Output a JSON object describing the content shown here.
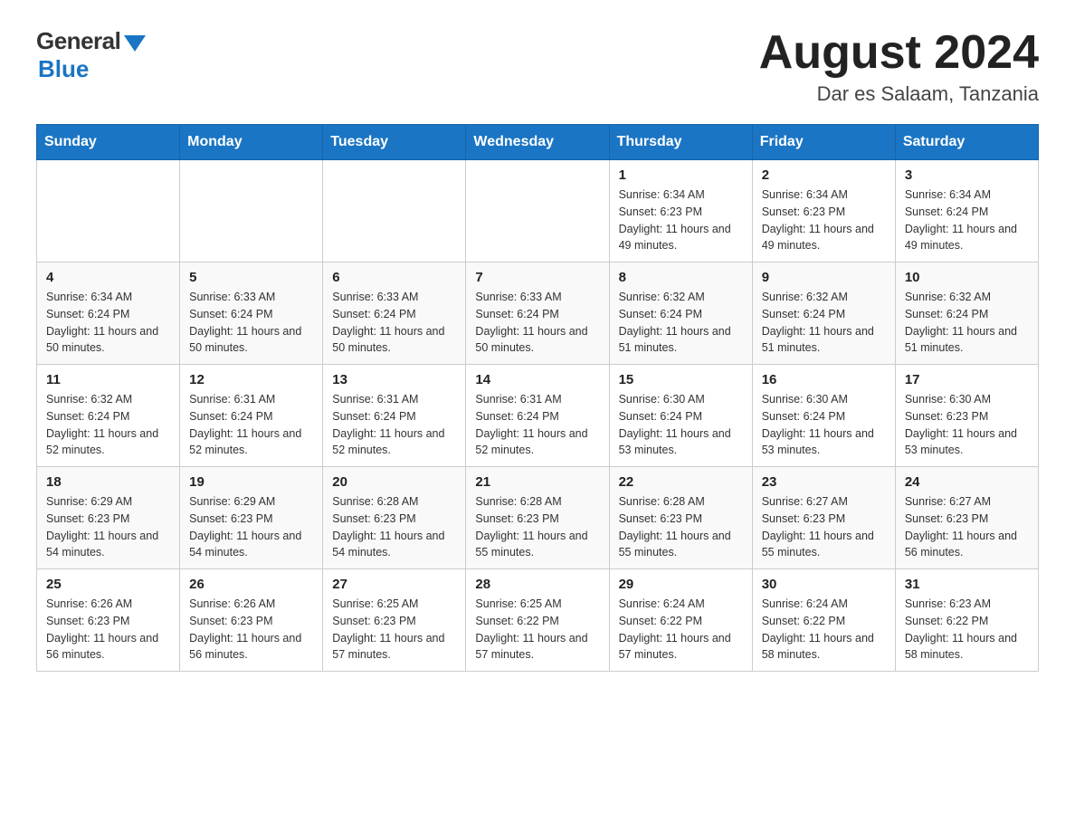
{
  "header": {
    "logo_general": "General",
    "logo_blue": "Blue",
    "month_title": "August 2024",
    "location": "Dar es Salaam, Tanzania"
  },
  "weekdays": [
    "Sunday",
    "Monday",
    "Tuesday",
    "Wednesday",
    "Thursday",
    "Friday",
    "Saturday"
  ],
  "weeks": [
    [
      {
        "day": "",
        "sunrise": "",
        "sunset": "",
        "daylight": ""
      },
      {
        "day": "",
        "sunrise": "",
        "sunset": "",
        "daylight": ""
      },
      {
        "day": "",
        "sunrise": "",
        "sunset": "",
        "daylight": ""
      },
      {
        "day": "",
        "sunrise": "",
        "sunset": "",
        "daylight": ""
      },
      {
        "day": "1",
        "sunrise": "Sunrise: 6:34 AM",
        "sunset": "Sunset: 6:23 PM",
        "daylight": "Daylight: 11 hours and 49 minutes."
      },
      {
        "day": "2",
        "sunrise": "Sunrise: 6:34 AM",
        "sunset": "Sunset: 6:23 PM",
        "daylight": "Daylight: 11 hours and 49 minutes."
      },
      {
        "day": "3",
        "sunrise": "Sunrise: 6:34 AM",
        "sunset": "Sunset: 6:24 PM",
        "daylight": "Daylight: 11 hours and 49 minutes."
      }
    ],
    [
      {
        "day": "4",
        "sunrise": "Sunrise: 6:34 AM",
        "sunset": "Sunset: 6:24 PM",
        "daylight": "Daylight: 11 hours and 50 minutes."
      },
      {
        "day": "5",
        "sunrise": "Sunrise: 6:33 AM",
        "sunset": "Sunset: 6:24 PM",
        "daylight": "Daylight: 11 hours and 50 minutes."
      },
      {
        "day": "6",
        "sunrise": "Sunrise: 6:33 AM",
        "sunset": "Sunset: 6:24 PM",
        "daylight": "Daylight: 11 hours and 50 minutes."
      },
      {
        "day": "7",
        "sunrise": "Sunrise: 6:33 AM",
        "sunset": "Sunset: 6:24 PM",
        "daylight": "Daylight: 11 hours and 50 minutes."
      },
      {
        "day": "8",
        "sunrise": "Sunrise: 6:32 AM",
        "sunset": "Sunset: 6:24 PM",
        "daylight": "Daylight: 11 hours and 51 minutes."
      },
      {
        "day": "9",
        "sunrise": "Sunrise: 6:32 AM",
        "sunset": "Sunset: 6:24 PM",
        "daylight": "Daylight: 11 hours and 51 minutes."
      },
      {
        "day": "10",
        "sunrise": "Sunrise: 6:32 AM",
        "sunset": "Sunset: 6:24 PM",
        "daylight": "Daylight: 11 hours and 51 minutes."
      }
    ],
    [
      {
        "day": "11",
        "sunrise": "Sunrise: 6:32 AM",
        "sunset": "Sunset: 6:24 PM",
        "daylight": "Daylight: 11 hours and 52 minutes."
      },
      {
        "day": "12",
        "sunrise": "Sunrise: 6:31 AM",
        "sunset": "Sunset: 6:24 PM",
        "daylight": "Daylight: 11 hours and 52 minutes."
      },
      {
        "day": "13",
        "sunrise": "Sunrise: 6:31 AM",
        "sunset": "Sunset: 6:24 PM",
        "daylight": "Daylight: 11 hours and 52 minutes."
      },
      {
        "day": "14",
        "sunrise": "Sunrise: 6:31 AM",
        "sunset": "Sunset: 6:24 PM",
        "daylight": "Daylight: 11 hours and 52 minutes."
      },
      {
        "day": "15",
        "sunrise": "Sunrise: 6:30 AM",
        "sunset": "Sunset: 6:24 PM",
        "daylight": "Daylight: 11 hours and 53 minutes."
      },
      {
        "day": "16",
        "sunrise": "Sunrise: 6:30 AM",
        "sunset": "Sunset: 6:24 PM",
        "daylight": "Daylight: 11 hours and 53 minutes."
      },
      {
        "day": "17",
        "sunrise": "Sunrise: 6:30 AM",
        "sunset": "Sunset: 6:23 PM",
        "daylight": "Daylight: 11 hours and 53 minutes."
      }
    ],
    [
      {
        "day": "18",
        "sunrise": "Sunrise: 6:29 AM",
        "sunset": "Sunset: 6:23 PM",
        "daylight": "Daylight: 11 hours and 54 minutes."
      },
      {
        "day": "19",
        "sunrise": "Sunrise: 6:29 AM",
        "sunset": "Sunset: 6:23 PM",
        "daylight": "Daylight: 11 hours and 54 minutes."
      },
      {
        "day": "20",
        "sunrise": "Sunrise: 6:28 AM",
        "sunset": "Sunset: 6:23 PM",
        "daylight": "Daylight: 11 hours and 54 minutes."
      },
      {
        "day": "21",
        "sunrise": "Sunrise: 6:28 AM",
        "sunset": "Sunset: 6:23 PM",
        "daylight": "Daylight: 11 hours and 55 minutes."
      },
      {
        "day": "22",
        "sunrise": "Sunrise: 6:28 AM",
        "sunset": "Sunset: 6:23 PM",
        "daylight": "Daylight: 11 hours and 55 minutes."
      },
      {
        "day": "23",
        "sunrise": "Sunrise: 6:27 AM",
        "sunset": "Sunset: 6:23 PM",
        "daylight": "Daylight: 11 hours and 55 minutes."
      },
      {
        "day": "24",
        "sunrise": "Sunrise: 6:27 AM",
        "sunset": "Sunset: 6:23 PM",
        "daylight": "Daylight: 11 hours and 56 minutes."
      }
    ],
    [
      {
        "day": "25",
        "sunrise": "Sunrise: 6:26 AM",
        "sunset": "Sunset: 6:23 PM",
        "daylight": "Daylight: 11 hours and 56 minutes."
      },
      {
        "day": "26",
        "sunrise": "Sunrise: 6:26 AM",
        "sunset": "Sunset: 6:23 PM",
        "daylight": "Daylight: 11 hours and 56 minutes."
      },
      {
        "day": "27",
        "sunrise": "Sunrise: 6:25 AM",
        "sunset": "Sunset: 6:23 PM",
        "daylight": "Daylight: 11 hours and 57 minutes."
      },
      {
        "day": "28",
        "sunrise": "Sunrise: 6:25 AM",
        "sunset": "Sunset: 6:22 PM",
        "daylight": "Daylight: 11 hours and 57 minutes."
      },
      {
        "day": "29",
        "sunrise": "Sunrise: 6:24 AM",
        "sunset": "Sunset: 6:22 PM",
        "daylight": "Daylight: 11 hours and 57 minutes."
      },
      {
        "day": "30",
        "sunrise": "Sunrise: 6:24 AM",
        "sunset": "Sunset: 6:22 PM",
        "daylight": "Daylight: 11 hours and 58 minutes."
      },
      {
        "day": "31",
        "sunrise": "Sunrise: 6:23 AM",
        "sunset": "Sunset: 6:22 PM",
        "daylight": "Daylight: 11 hours and 58 minutes."
      }
    ]
  ]
}
